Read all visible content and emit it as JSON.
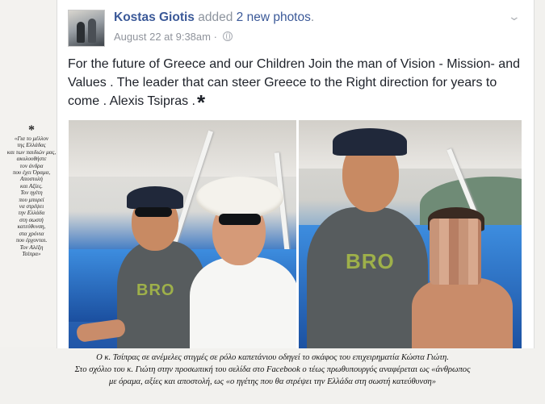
{
  "side_note": {
    "marker": "*",
    "lines": [
      "«Για το μέλλον",
      "της Ελλάδας",
      "και των παιδιών μας,",
      "ακολουθήστε",
      "τον άνδρα",
      "που έχει Όραμα,",
      "Αποστολή",
      "και Αξίες.",
      "Τον ηγέτη",
      "που μπορεί",
      "να στρέψει",
      "την Ελλάδα",
      "στη σωστή",
      "κατεύθυνση,",
      "στα χρόνια",
      "που έρχονται.",
      "Τον Αλέξη",
      "Τσίπρα»"
    ]
  },
  "post": {
    "author": "Kostas Giotis",
    "action": "added",
    "photos_link": "2 new photos",
    "period": ".",
    "date": "August 22 at 9:38am",
    "separator": "·",
    "text": "For the future of Greece and our Children Join the man of Vision - Mission- and Values . The leader that can steer Greece to the Right direction for years to come . Alexis Tsipras .",
    "star": "*",
    "icons": {
      "privacy": "globe-icon",
      "menu": "chevron-down-icon"
    },
    "photos": [
      {
        "shirt_text": "BRO"
      },
      {
        "shirt_text": "BRO"
      }
    ]
  },
  "caption": {
    "lines": [
      "Ο κ. Τσίπρας σε ανέμελες στιγμές σε ρόλο καπετάνιου οδηγεί το σκάφος του επιχειρηματία Κώστα Γιώτη.",
      "Στο σχόλιο του κ. Γιώτη στην προσωπική του σελίδα στο Facebook ο τέως πρωθυπουργός αναφέρεται ως «άνθρωπος",
      "με όραμα, αξίες και αποστολή, ως «ο ηγέτης που θα στρέψει την Ελλάδα στη σωστή κατεύθυνση»"
    ]
  },
  "colors": {
    "fb_blue": "#3b5998",
    "meta_grey": "#90949c",
    "body_text": "#1d2129"
  }
}
